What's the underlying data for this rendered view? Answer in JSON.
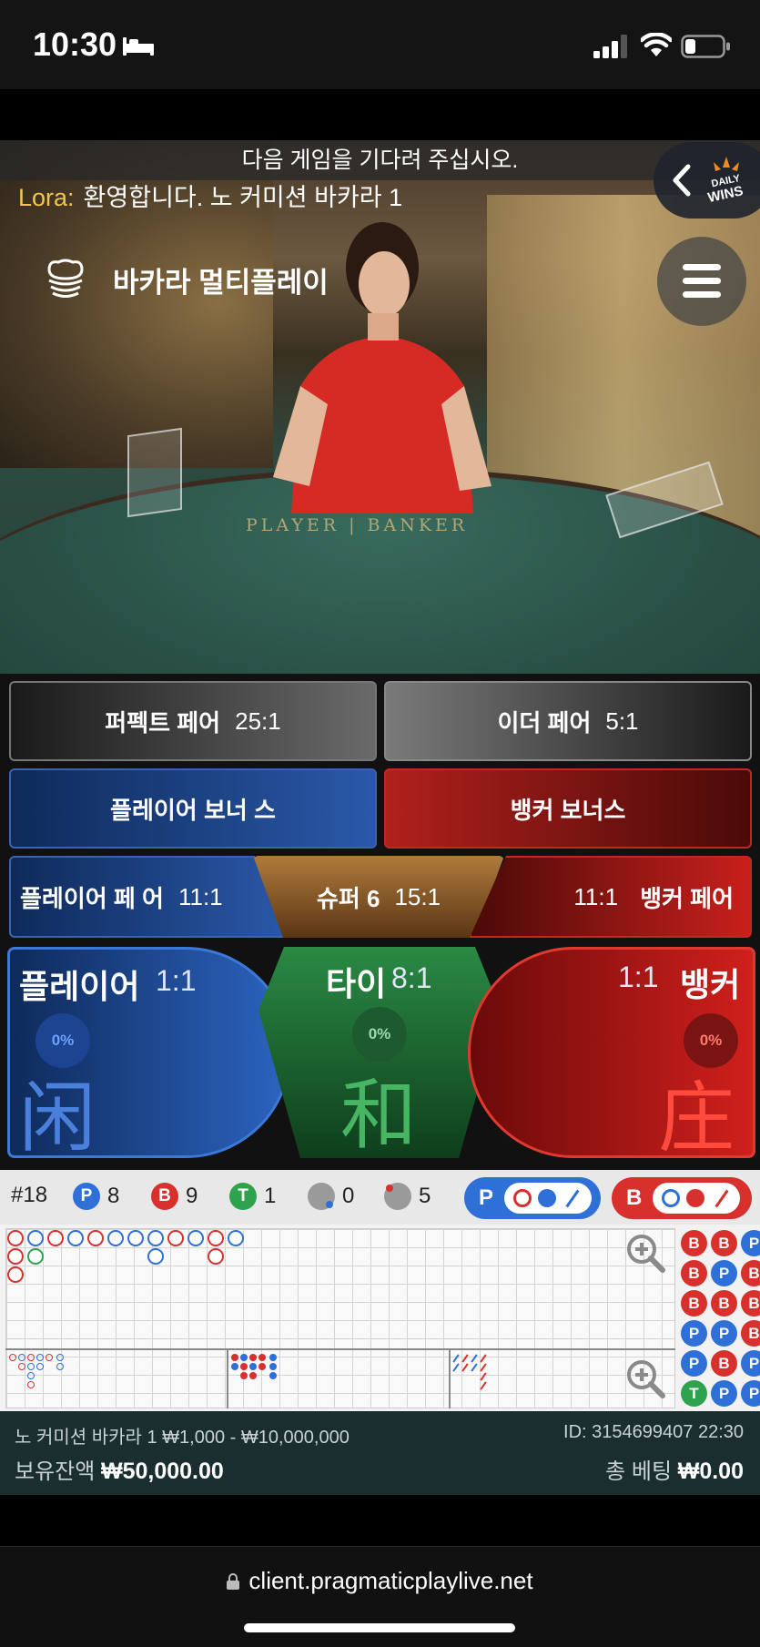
{
  "status_bar": {
    "time": "10:30"
  },
  "video": {
    "notice": "다음 게임을 기다려 주십시오.",
    "chat_user": "Lora:",
    "chat_message": "환영합니다. 노 커미션 바카라 1",
    "game_title": "바카라 멀티플레이",
    "table_text": "PLAYER | BANKER",
    "daily_wins_logo": [
      "DAILY",
      "WINS"
    ]
  },
  "bets": {
    "perfect_pair": {
      "label": "퍼펙트 페어",
      "odds": "25:1"
    },
    "either_pair": {
      "label": "이더 페어",
      "odds": "5:1"
    },
    "player_bonus": {
      "label": "플레이어 보너 스"
    },
    "banker_bonus": {
      "label": "뱅커 보너스"
    },
    "player_pair": {
      "label": "플레이어 페 어",
      "odds": "11:1"
    },
    "super6": {
      "label": "슈퍼 6",
      "odds": "15:1"
    },
    "banker_pair": {
      "label": "뱅커 페어",
      "odds": "11:1"
    },
    "player": {
      "label": "플레이어",
      "odds": "1:1",
      "percent": "0%",
      "hanzi": "闲"
    },
    "tie": {
      "label": "타이",
      "odds": "8:1",
      "percent": "0%",
      "hanzi": "和"
    },
    "banker": {
      "label": "뱅커",
      "odds": "1:1",
      "percent": "0%",
      "hanzi": "庄"
    }
  },
  "stats": {
    "round": "#18",
    "player_letter": "P",
    "player_count": "8",
    "banker_letter": "B",
    "banker_count": "9",
    "tie_letter": "T",
    "tie_count": "1",
    "player_pair_count": "0",
    "banker_pair_count": "5",
    "predict_player": "P",
    "predict_banker": "B"
  },
  "colors": {
    "player": "#2f6fd8",
    "banker": "#d8302c",
    "tie": "#2fa24e"
  },
  "roads": {
    "bead_plate": [
      [
        "B",
        "B",
        "P"
      ],
      [
        "B",
        "P",
        "B"
      ],
      [
        "B",
        "B",
        "B"
      ],
      [
        "P",
        "P",
        "B"
      ],
      [
        "P",
        "B",
        "P"
      ],
      [
        "T",
        "P",
        "P"
      ]
    ]
  },
  "info": {
    "limits": "노 커미션 바카라 1 ₩1,000 - ₩10,000,000",
    "balance_label": "보유잔액",
    "balance": "₩50,000.00",
    "id": "ID: 3154699407 22:30",
    "total_label": "총 베팅",
    "total": "₩0.00"
  },
  "browser": {
    "url": "client.pragmaticplaylive.net"
  }
}
